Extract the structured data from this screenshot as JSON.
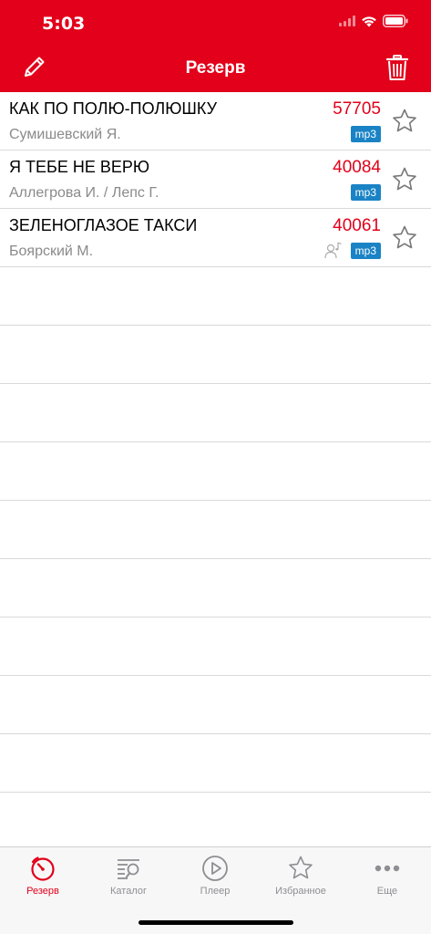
{
  "status": {
    "time": "5:03"
  },
  "nav": {
    "title": "Резерв"
  },
  "songs": [
    {
      "title": "КАК ПО ПОЛЮ-ПОЛЮШКУ",
      "artist": "Сумишевский Я.",
      "code": "57705",
      "format": "mp3"
    },
    {
      "title": "Я ТЕБЕ НЕ ВЕРЮ",
      "artist": "Аллегрова И. / Лепс Г.",
      "code": "40084",
      "format": "mp3"
    },
    {
      "title": "ЗЕЛЕНОГЛАЗОЕ ТАКСИ",
      "artist": "Боярский М.",
      "code": "40061",
      "format": "mp3"
    }
  ],
  "tabs": [
    {
      "label": "Резерв",
      "icon": "stopwatch-icon",
      "active": true
    },
    {
      "label": "Каталог",
      "icon": "catalog-search-icon"
    },
    {
      "label": "Плеер",
      "icon": "play-circle-icon"
    },
    {
      "label": "Избранное",
      "icon": "star-icon"
    },
    {
      "label": "Еще",
      "icon": "more-dots-icon"
    }
  ],
  "colors": {
    "accent": "#e2001a",
    "badge": "#1a83c6",
    "inactive": "#8e8e93"
  }
}
